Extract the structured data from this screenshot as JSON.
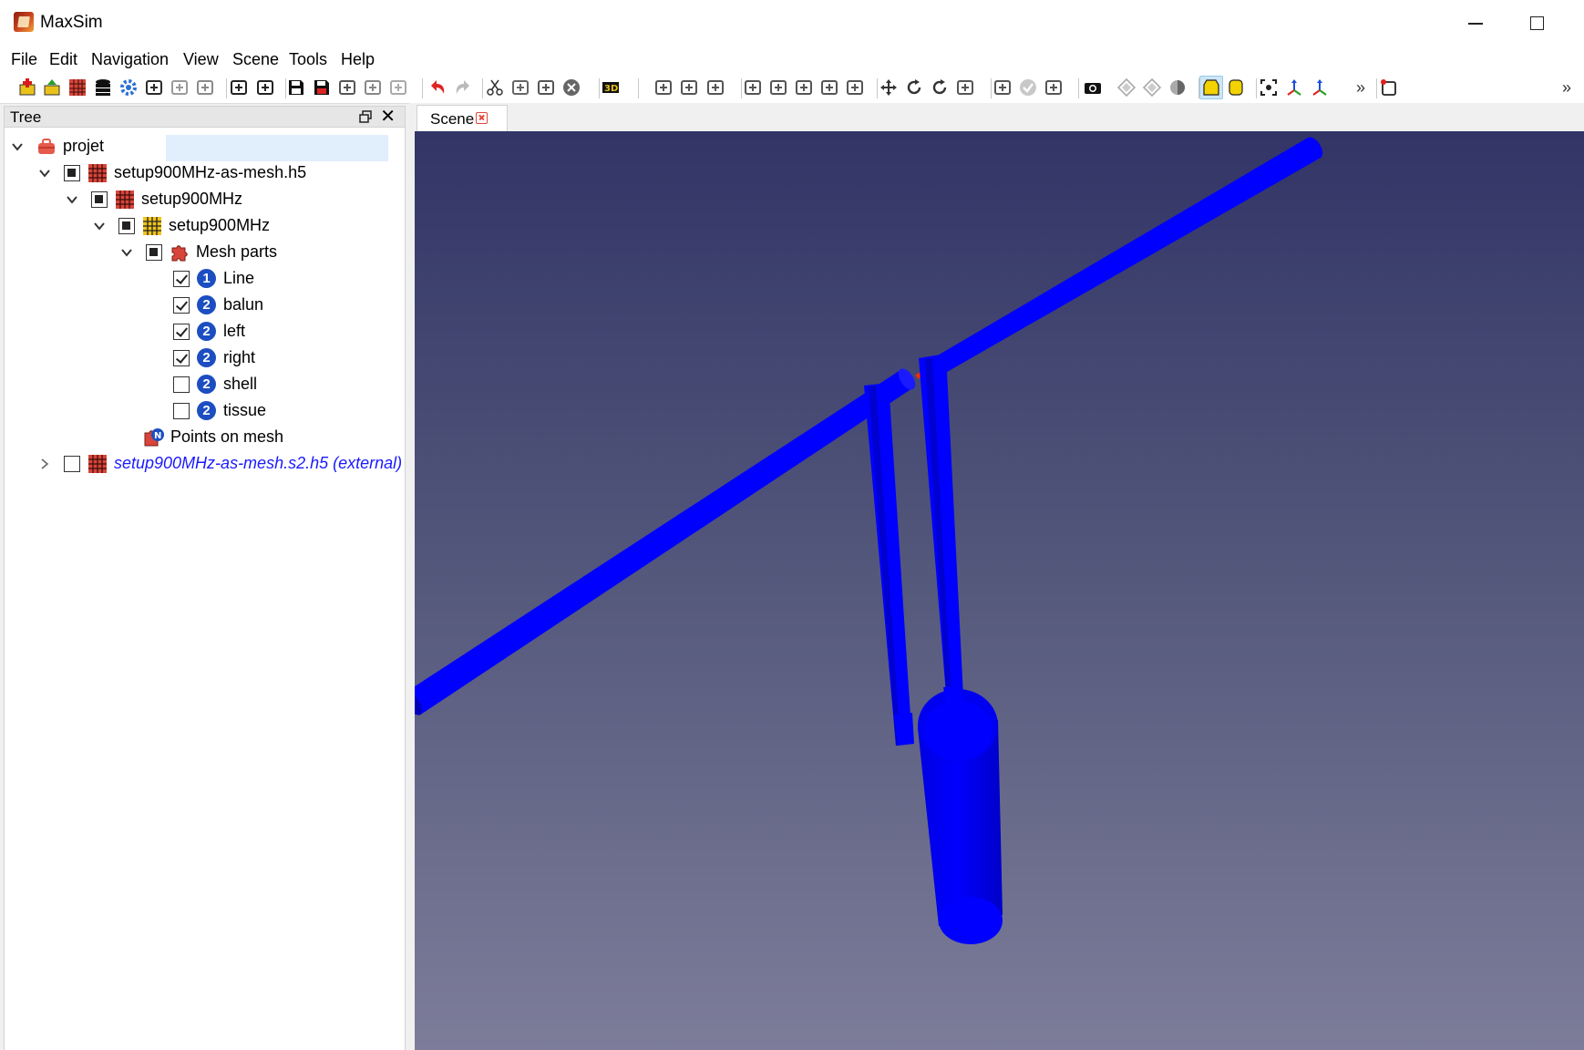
{
  "window": {
    "title": "MaxSim"
  },
  "menu": [
    "File",
    "Edit",
    "Navigation",
    "View",
    "Scene",
    "Tools",
    "Help"
  ],
  "toolbar": {
    "icons": [
      "new-project-icon",
      "open-project-icon",
      "mesh-icon",
      "database-icon",
      "settings-gear-icon",
      "chart-icon",
      "bar-chart-icon",
      "tools-icon",
      "import-icon",
      "export-icon",
      "save-icon",
      "save-as-icon",
      "save-all-icon",
      "sphere-icon",
      "solver-icon",
      "undo-icon",
      "redo-icon",
      "cut-icon",
      "copy-icon",
      "paste-icon",
      "delete-icon",
      "3d-icon",
      "add-part-icon",
      "edit-part-icon",
      "remove-part-icon",
      "cloud-icon",
      "probe-icon",
      "source-icon",
      "rotate-part-icon",
      "transform-icon",
      "move-icon",
      "rotate-icon",
      "refresh-icon",
      "scale-icon",
      "reset-icon",
      "validate-icon",
      "run-icon",
      "camera-icon",
      "view-front-icon",
      "view-side-icon",
      "view-iso-icon",
      "shading-smooth-icon",
      "shading-flat-icon",
      "fit-view-icon",
      "axes-icon",
      "axes-small-icon",
      "box-view-icon"
    ],
    "overflow_label": "»",
    "active_index": 41
  },
  "tree": {
    "title": "Tree",
    "items": [
      {
        "label": "projet",
        "icon": "project-briefcase-icon",
        "expanded": true,
        "checkbox": "none"
      },
      {
        "label": "setup900MHz-as-mesh.h5",
        "icon": "mesh-file-icon",
        "expanded": true,
        "checkbox": "partial"
      },
      {
        "label": "setup900MHz",
        "icon": "mesh-file-icon",
        "expanded": true,
        "checkbox": "partial"
      },
      {
        "label": "setup900MHz",
        "icon": "mesh-grid-icon",
        "expanded": true,
        "checkbox": "partial"
      },
      {
        "label": "Mesh parts",
        "icon": "puzzle-icon",
        "expanded": true,
        "checkbox": "partial"
      },
      {
        "label": "Line",
        "badge": "1",
        "checkbox": "checked",
        "selected": true
      },
      {
        "label": "balun",
        "badge": "2",
        "checkbox": "checked"
      },
      {
        "label": "left",
        "badge": "2",
        "checkbox": "checked"
      },
      {
        "label": "right",
        "badge": "2",
        "checkbox": "checked"
      },
      {
        "label": "shell",
        "badge": "2",
        "checkbox": "unchecked"
      },
      {
        "label": "tissue",
        "badge": "2",
        "checkbox": "unchecked"
      },
      {
        "label": "Points on mesh",
        "icon": "points-on-mesh-icon",
        "checkbox": "none"
      },
      {
        "label": "setup900MHz-as-mesh.s2.h5 (external)",
        "icon": "mesh-file-icon",
        "expanded": false,
        "checkbox": "unchecked",
        "external": true
      }
    ]
  },
  "scene_tab": {
    "label": "Scene"
  },
  "scene": {
    "background_top": "#323566",
    "background_bottom": "#7d7d9a",
    "object_color": "#0000ff",
    "feed_color": "#ff2a00"
  }
}
